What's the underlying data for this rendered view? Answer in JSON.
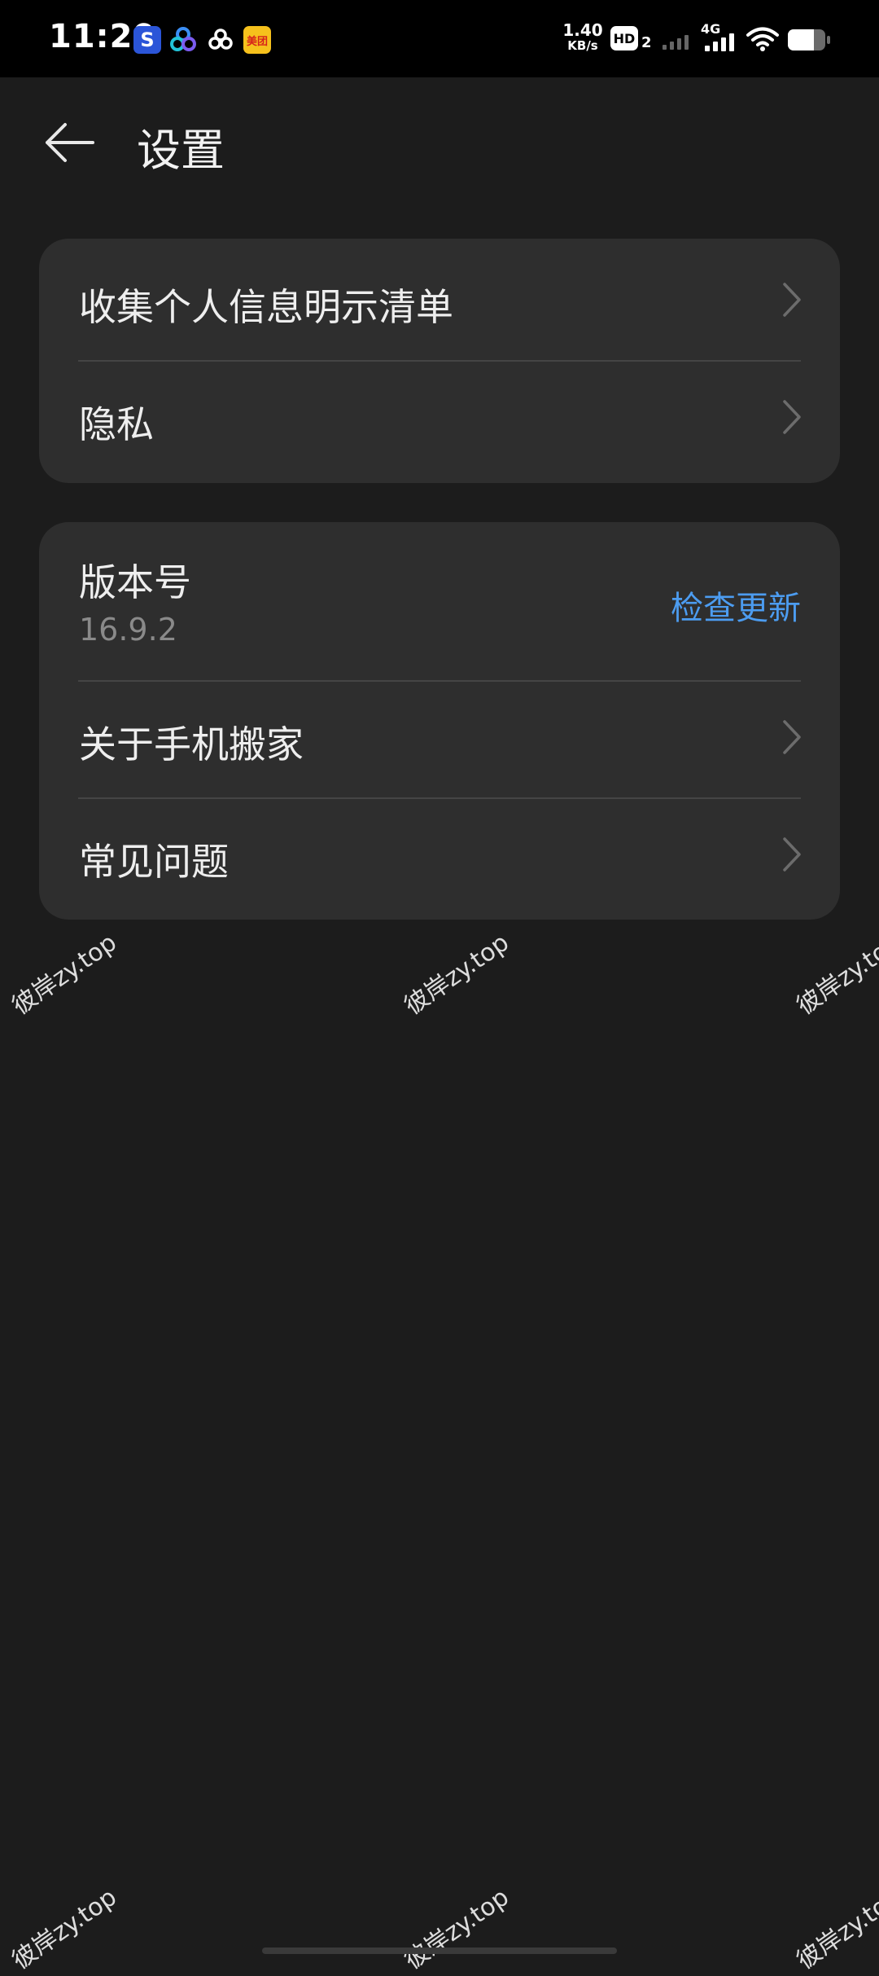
{
  "status_bar": {
    "time": "11:29",
    "app_icons": [
      "S",
      "",
      "",
      "美团"
    ],
    "net_speed_value": "1.40",
    "net_speed_unit": "KB/s",
    "hd_label": "HD",
    "hd_sub": "2",
    "network_type": "4G",
    "battery_level": 0.7
  },
  "header": {
    "title": "设置"
  },
  "card1": {
    "items": [
      {
        "label": "收集个人信息明示清单"
      },
      {
        "label": "隐私"
      }
    ]
  },
  "card2": {
    "version_label": "版本号",
    "version_value": "16.9.2",
    "check_update_label": "检查更新",
    "items": [
      {
        "label": "关于手机搬家"
      },
      {
        "label": "常见问题"
      }
    ]
  },
  "watermark_text": "彼岸zy.top"
}
